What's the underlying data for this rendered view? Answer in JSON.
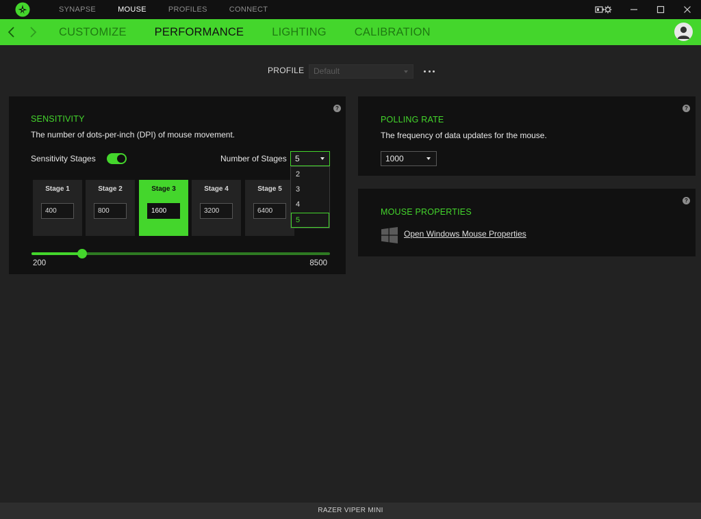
{
  "topnav": {
    "items": [
      "SYNAPSE",
      "MOUSE",
      "PROFILES",
      "CONNECT"
    ],
    "active": "MOUSE"
  },
  "subnav": {
    "items": [
      "CUSTOMIZE",
      "PERFORMANCE",
      "LIGHTING",
      "CALIBRATION"
    ],
    "active": "PERFORMANCE"
  },
  "profile": {
    "label": "PROFILE",
    "value": "Default"
  },
  "sensitivity": {
    "title": "SENSITIVITY",
    "description": "The number of dots-per-inch (DPI) of mouse movement.",
    "stages_toggle_label": "Sensitivity Stages",
    "stages_toggle_on": true,
    "number_of_stages_label": "Number of Stages",
    "number_of_stages_value": "5",
    "number_of_stages_options": [
      "2",
      "3",
      "4",
      "5"
    ],
    "stages": [
      {
        "label": "Stage 1",
        "value": "400"
      },
      {
        "label": "Stage 2",
        "value": "800"
      },
      {
        "label": "Stage 3",
        "value": "1600"
      },
      {
        "label": "Stage 4",
        "value": "3200"
      },
      {
        "label": "Stage 5",
        "value": "6400"
      }
    ],
    "active_stage": "Stage 3",
    "slider_min": "200",
    "slider_max": "8500",
    "slider_value": 1600
  },
  "polling": {
    "title": "POLLING RATE",
    "description": "The frequency of data updates for the mouse.",
    "value": "1000"
  },
  "mouse_properties": {
    "title": "MOUSE PROPERTIES",
    "link": "Open Windows Mouse Properties"
  },
  "footer": {
    "device": "RAZER VIPER MINI"
  },
  "help_glyph": "?",
  "colors": {
    "accent": "#44d62c",
    "panel": "#111111",
    "background": "#222222"
  },
  "icons": [
    "razer-logo-icon",
    "back-arrow-icon",
    "forward-arrow-icon",
    "user-avatar-icon",
    "windows-logo-icon",
    "help-icon",
    "more-options-icon"
  ]
}
